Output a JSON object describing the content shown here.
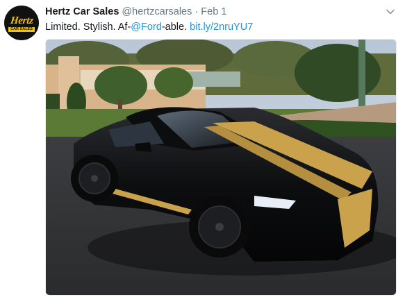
{
  "tweet": {
    "author_name": "Hertz Car Sales",
    "handle": "@hertzcarsales",
    "separator": "·",
    "date": "Feb 1",
    "text_prefix": "Limited. Stylish. Af-",
    "mention": "@Ford",
    "text_middle": "-able. ",
    "link": "bit.ly/2nruYU7"
  },
  "avatar": {
    "logo_text": "Hertz",
    "logo_subtext": "CAR SALES",
    "brand_color": "#f5c400"
  },
  "icons": {
    "more": "chevron-down-icon"
  },
  "media": {
    "description_icon": "photo",
    "car_color": "#0b0b0c",
    "stripe_color": "#c9a24b"
  },
  "colors": {
    "link": "#1b95e0",
    "secondary_text": "#657786",
    "primary_text": "#14171a"
  }
}
